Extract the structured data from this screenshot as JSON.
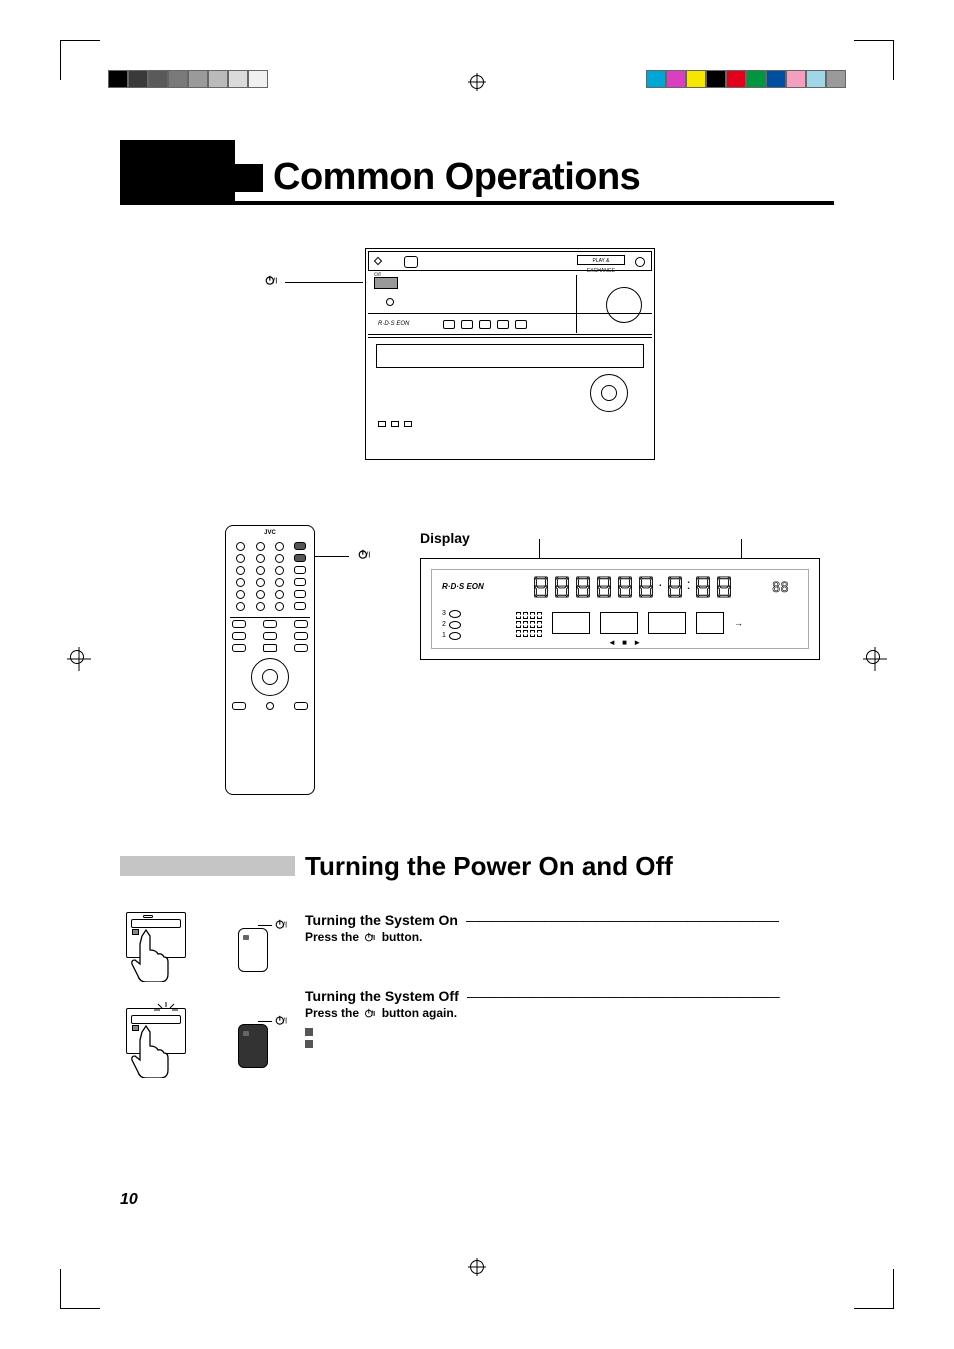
{
  "page_number": "10",
  "heading": "Common Operations",
  "main_unit_callout": "⏻/I",
  "rds_label": "R·D·S EON",
  "disc_tray_label": "PLAY & EXCHANGE",
  "remote": {
    "brand": "JVC",
    "callout": "⏻/I"
  },
  "display_section": {
    "title": "Display",
    "rds": "R·D·S EON",
    "track_nums": [
      "3",
      "2",
      "1"
    ],
    "big_seg": "88"
  },
  "section2": {
    "title": "Turning the Power On and Off",
    "on": {
      "heading": "Turning the System On",
      "instr_pre": "Press the ",
      "instr_post": " button."
    },
    "off": {
      "heading": "Turning the System Off",
      "instr_pre": "Press the ",
      "instr_post": " button again."
    },
    "remote_sym": "⏻/I"
  },
  "swatch_colors_left": [
    "#000",
    "#3a3a3a",
    "#5a5a5a",
    "#7a7a7a",
    "#9a9a9a",
    "#bababa",
    "#dadada",
    "#f0f0f0"
  ],
  "swatch_colors_right": [
    "#00a6d6",
    "#d93fbf",
    "#f7e600",
    "#000",
    "#e2001a",
    "#009640",
    "#004f9e",
    "#f59fbf",
    "#9fd6e8",
    "#9a9a9a"
  ]
}
